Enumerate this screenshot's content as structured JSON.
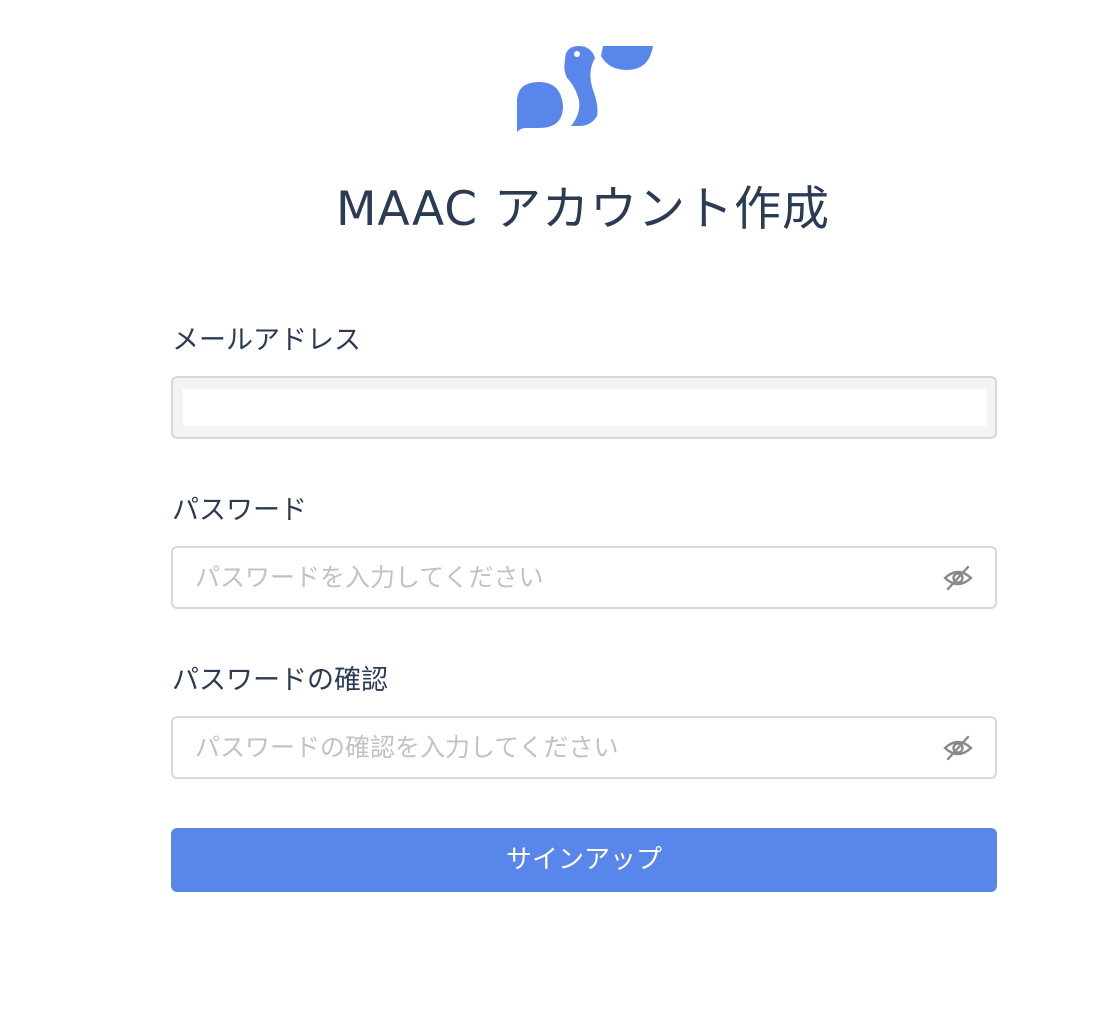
{
  "page": {
    "title": "MAAC アカウント作成"
  },
  "brand": {
    "logo_icon": "pelican-logo-icon",
    "accent_color": "#5886ea"
  },
  "form": {
    "email": {
      "label": "メールアドレス",
      "value": "",
      "placeholder": ""
    },
    "password": {
      "label": "パスワード",
      "value": "",
      "placeholder": "パスワードを入力してください",
      "toggle_icon": "eye-off-icon"
    },
    "password_confirm": {
      "label": "パスワードの確認",
      "value": "",
      "placeholder": "パスワードの確認を入力してください",
      "toggle_icon": "eye-off-icon"
    },
    "submit_label": "サインアップ"
  }
}
